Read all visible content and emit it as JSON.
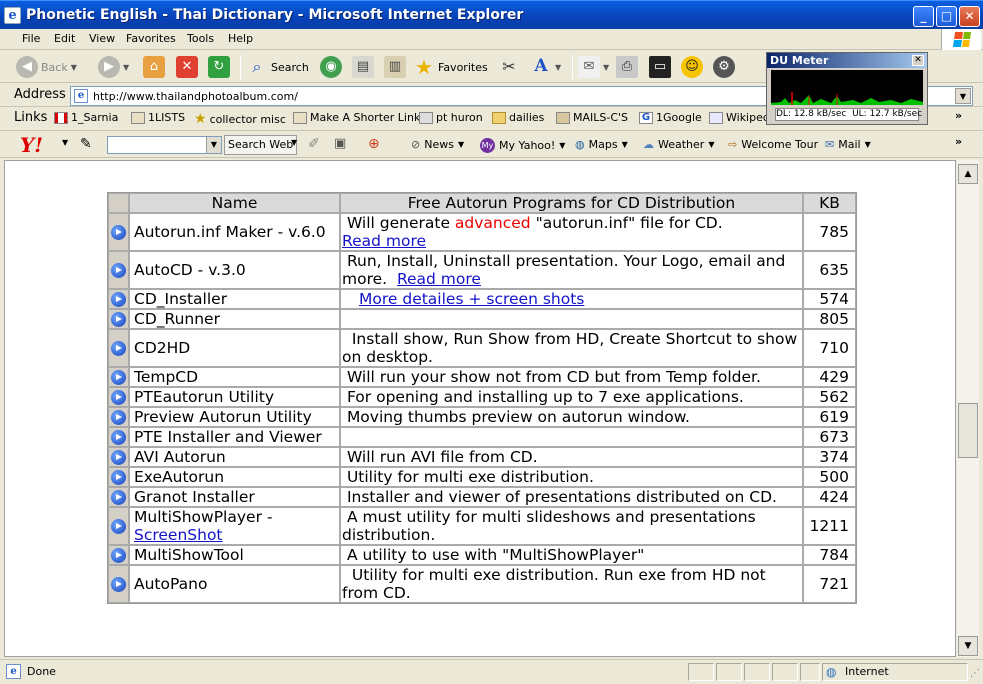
{
  "window": {
    "title": "Phonetic English - Thai Dictionary - Microsoft Internet Explorer"
  },
  "menu": {
    "file": "File",
    "edit": "Edit",
    "view": "View",
    "favorites": "Favorites",
    "tools": "Tools",
    "help": "Help"
  },
  "toolbar": {
    "back": "Back",
    "search": "Search",
    "favorites": "Favorites"
  },
  "address": {
    "label": "Address",
    "url": "http://www.thailandphotoalbum.com/"
  },
  "links": {
    "label": "Links",
    "items": [
      "1_Sarnia",
      "1LISTS",
      "collector misc",
      "Make A Shorter Link",
      "pt huron",
      "dailies",
      "MAILS-C'S",
      "1Google",
      "Wikipedia"
    ]
  },
  "yahoo": {
    "search_web": "Search Web",
    "news": "News",
    "my_yahoo": "My Yahoo!",
    "maps": "Maps",
    "weather": "Weather",
    "welcome_tour": "Welcome Tour",
    "mail": "Mail"
  },
  "du_meter": {
    "title": "DU Meter",
    "dl": "DL: 12.8 kB/sec",
    "ul": "UL: 12.7 kB/sec"
  },
  "table": {
    "headers": {
      "name": "Name",
      "description": "Free Autorun Programs for CD Distribution",
      "kb": "KB"
    },
    "rows": [
      {
        "name": "Autorun.inf Maker - v.6.0",
        "d1": " Will generate ",
        "d_red": "advanced",
        "d2": " \"autorun.inf\" file for CD.",
        "link": "Read more",
        "kb": "785"
      },
      {
        "name": "AutoCD - v.3.0",
        "d1": " Run, Install, Uninstall presentation. Your Logo, email and more.  ",
        "link": "Read more",
        "kb": "635"
      },
      {
        "name": "CD_Installer",
        "link": "More detailes + screen shots",
        "kb": "574"
      },
      {
        "name": "CD_Runner",
        "kb": "805"
      },
      {
        "name": "CD2HD",
        "d1": "  Install show, Run Show from HD, Create Shortcut to show on desktop.",
        "kb": "710"
      },
      {
        "name": "TempCD",
        "d1": " Will run your show not from CD but from Temp folder.",
        "kb": "429"
      },
      {
        "name": "PTEautorun Utility",
        "d1": " For opening and installing up to 7 exe applications.",
        "kb": "562"
      },
      {
        "name": "Preview Autorun Utility",
        "d1": " Moving thumbs preview on autorun window.",
        "kb": "619"
      },
      {
        "name": "PTE Installer and Viewer",
        "kb": "673"
      },
      {
        "name": "AVI Autorun",
        "d1": " Will run AVI file from CD.",
        "kb": "374"
      },
      {
        "name": "ExeAutorun",
        "d1": " Utility for multi exe distribution.",
        "kb": "500"
      },
      {
        "name": "Granot Installer",
        "d1": " Installer and viewer of presentations distributed on CD.",
        "kb": "424"
      },
      {
        "name": "MultiShowPlayer - ",
        "name_link": "ScreenShot",
        "d1": " A must utility for multi slideshows and presentations distribution.",
        "kb": "1211"
      },
      {
        "name": "MultiShowTool",
        "d1": " A utility to use with \"MultiShowPlayer\"",
        "kb": "784"
      },
      {
        "name": "AutoPano",
        "d1": "  Utility for multi exe distribution. Run exe from HD not from CD.",
        "kb": "721"
      }
    ]
  },
  "status": {
    "text": "Done",
    "zone": "Internet"
  }
}
